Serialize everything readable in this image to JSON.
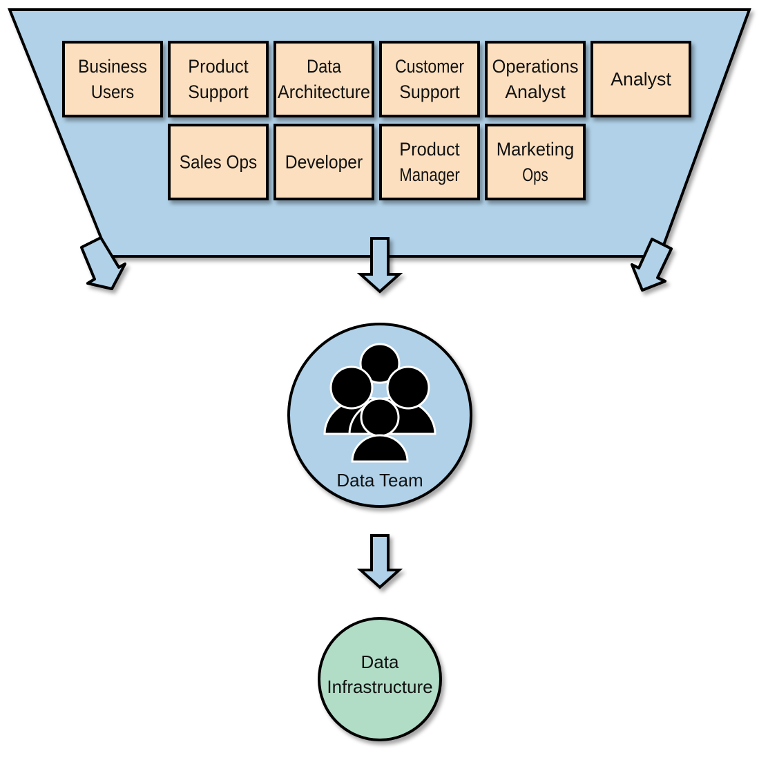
{
  "diagram": {
    "colors": {
      "funnel_fill": "#b0d1e8",
      "box_fill": "#fbdfbf",
      "team_fill": "#b0d1e8",
      "infra_fill": "#b1ddc7",
      "stroke": "#000000"
    },
    "roles_row1": [
      {
        "lines": [
          "Business",
          "Users"
        ]
      },
      {
        "lines": [
          "Product",
          "Support"
        ]
      },
      {
        "lines": [
          "Data",
          "Architecture"
        ]
      },
      {
        "lines": [
          "Customer",
          "Support"
        ]
      },
      {
        "lines": [
          "Operations",
          "Analyst"
        ]
      },
      {
        "lines": [
          "Analyst"
        ]
      }
    ],
    "roles_row2": [
      {
        "lines": [
          "Sales Ops"
        ]
      },
      {
        "lines": [
          "Developer"
        ]
      },
      {
        "lines": [
          "Product",
          "Manager"
        ]
      },
      {
        "lines": [
          "Marketing",
          "Ops"
        ]
      }
    ],
    "data_team": {
      "label": "Data Team",
      "icon": "people-group-icon"
    },
    "data_infrastructure": {
      "lines": [
        "Data",
        "Infrastructure"
      ]
    }
  }
}
